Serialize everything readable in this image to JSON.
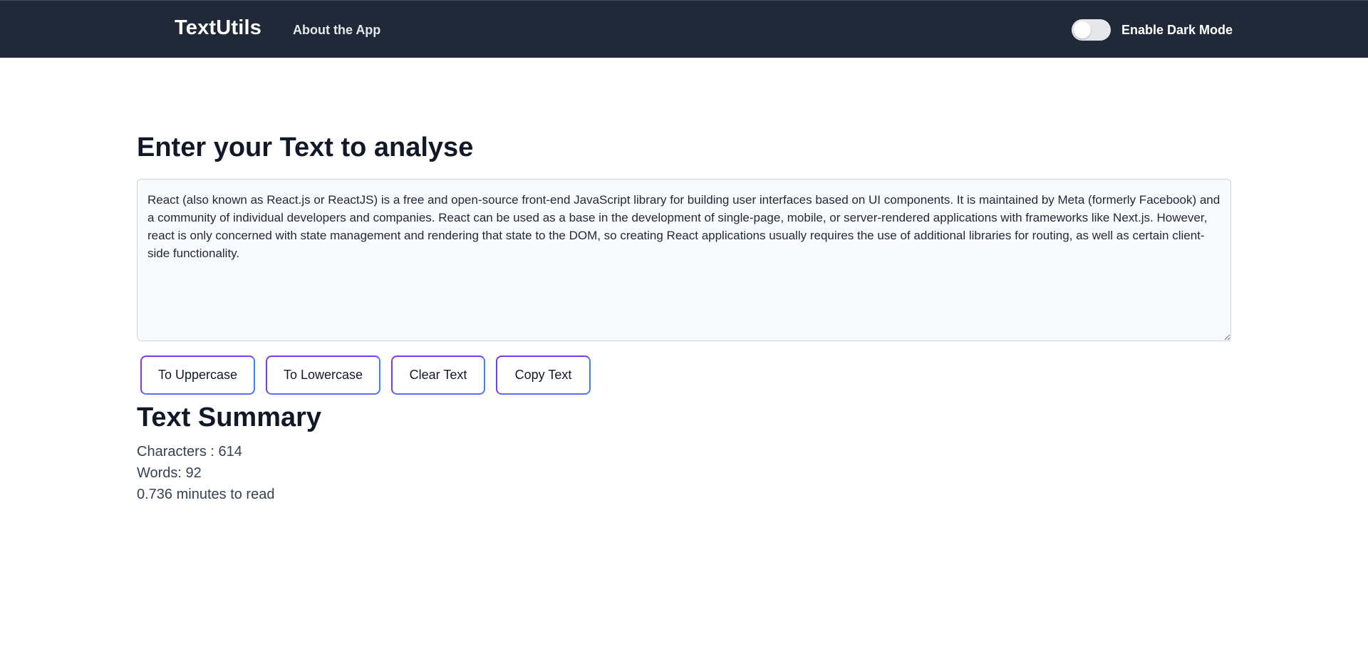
{
  "navbar": {
    "brand": "TextUtils",
    "about_link": "About the App",
    "dark_mode_label": "Enable Dark Mode",
    "dark_mode_enabled": false,
    "background_color": "#1f2937"
  },
  "main": {
    "heading": "Enter your Text to analyse",
    "textarea_value": "React (also known as React.js or ReactJS) is a free and open-source front-end JavaScript library for building user interfaces based on UI components. It is maintained by Meta (formerly Facebook) and a community of individual developers and companies. React can be used as a base in the development of single-page, mobile, or server-rendered applications with frameworks like Next.js. However, react is only concerned with state management and rendering that state to the DOM, so creating React applications usually requires the use of additional libraries for routing, as well as certain client-side functionality.",
    "buttons": {
      "uppercase": "To Uppercase",
      "lowercase": "To Lowercase",
      "clear": "Clear Text",
      "copy": "Copy Text"
    },
    "button_border_colors": [
      "#7c3aed",
      "#3b82f6"
    ]
  },
  "summary": {
    "heading": "Text Summary",
    "characters": "Characters : 614",
    "words": "Words: 92",
    "read_time": "0.736 minutes to read"
  }
}
